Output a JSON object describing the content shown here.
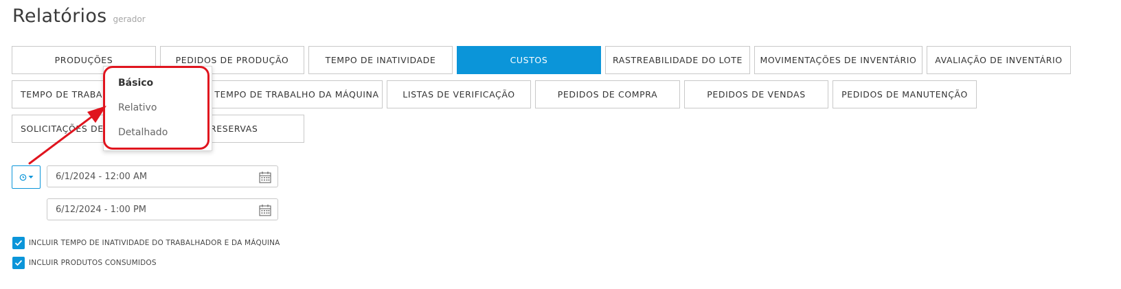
{
  "header": {
    "title": "Relatórios",
    "subtitle": "gerador"
  },
  "tabs_row1": [
    {
      "label": "PRODUÇÕES"
    },
    {
      "label": "PEDIDOS DE PRODUÇÃO"
    },
    {
      "label": "TEMPO DE INATIVIDADE"
    },
    {
      "label": "CUSTOS",
      "active": true
    },
    {
      "label": "RASTREABILIDADE DO LOTE"
    },
    {
      "label": "MOVIMENTAÇÕES DE INVENTÁRIO"
    },
    {
      "label": "AVALIAÇÃO DE INVENTÁRIO"
    }
  ],
  "tabs_row2": [
    {
      "label": "TEMPO DE TRABALHO"
    },
    {
      "label": "TEMPO DE TRABALHO DA MÁQUINA"
    },
    {
      "label": "LISTAS DE VERIFICAÇÃO"
    },
    {
      "label": "PEDIDOS DE COMPRA"
    },
    {
      "label": "PEDIDOS DE VENDAS"
    },
    {
      "label": "PEDIDOS DE MANUTENÇÃO"
    }
  ],
  "tabs_row3": [
    {
      "label": "SOLICITAÇÕES DE"
    },
    {
      "label": "RESERVAS"
    }
  ],
  "dropdown": {
    "items": [
      {
        "label": "Básico",
        "selected": true
      },
      {
        "label": "Relativo"
      },
      {
        "label": "Detalhado"
      }
    ]
  },
  "date_mode_button": {
    "icon": "clock-icon"
  },
  "date_from": {
    "value": "6/1/2024 - 12:00 AM",
    "icon": "calendar-icon"
  },
  "date_to": {
    "value": "6/12/2024 - 1:00 PM",
    "icon": "calendar-icon"
  },
  "options": [
    {
      "label": "INCLUIR TEMPO DE INATIVIDADE DO TRABALHADOR E DA MÁQUINA",
      "checked": true
    },
    {
      "label": "INCLUIR PRODUTOS CONSUMIDOS",
      "checked": true
    }
  ],
  "colors": {
    "accent": "#0b95d9",
    "annotation": "#e0141e",
    "border": "#c8c8c8"
  }
}
